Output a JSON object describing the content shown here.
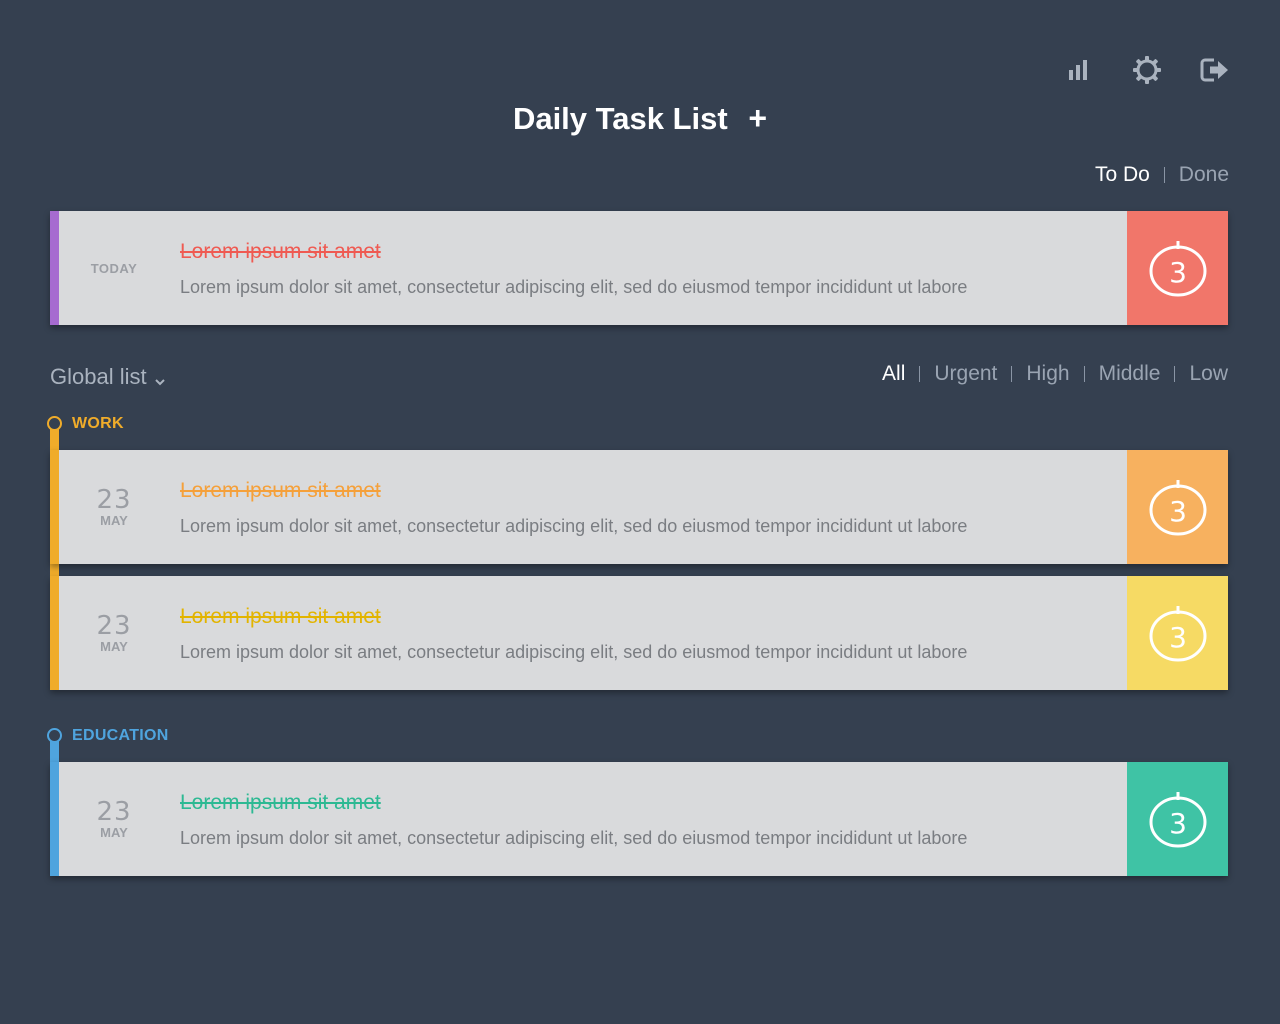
{
  "header": {
    "title": "Daily Task List",
    "add_symbol": "+",
    "icons": [
      "bar-chart-icon",
      "gear-icon",
      "logout-icon"
    ]
  },
  "view_tabs": [
    {
      "label": "To Do",
      "active": true
    },
    {
      "label": "Done",
      "active": false
    }
  ],
  "today_task": {
    "date_label": "TODAY",
    "title": "Lorem ipsum sit amet",
    "description": "Lorem ipsum dolor sit amet, consectetur adipiscing elit, sed do eiusmod tempor incididunt ut labore",
    "pomodoro_count": "3",
    "stripe_color": "#a66bd0",
    "title_color": "#ef5a52",
    "pomo_color": "#f1766a"
  },
  "list_selector": {
    "label": "Global list",
    "icon": "chevron-down-icon"
  },
  "filters": [
    {
      "label": "All",
      "active": true
    },
    {
      "label": "Urgent",
      "active": false
    },
    {
      "label": "High",
      "active": false
    },
    {
      "label": "Middle",
      "active": false
    },
    {
      "label": "Low",
      "active": false
    }
  ],
  "categories": [
    {
      "name": "WORK",
      "color": "#f0ac2a",
      "tasks": [
        {
          "day": "23",
          "month": "MAY",
          "title": "Lorem ipsum sit amet",
          "description": "Lorem ipsum dolor sit amet, consectetur adipiscing elit, sed do eiusmod tempor incididunt ut labore",
          "pomodoro_count": "3",
          "title_color": "#f5a03a",
          "pomo_color": "#f7b15f"
        },
        {
          "day": "23",
          "month": "MAY",
          "title": "Lorem ipsum sit amet",
          "description": "Lorem ipsum dolor sit amet, consectetur adipiscing elit, sed do eiusmod tempor incididunt ut labore",
          "pomodoro_count": "3",
          "title_color": "#e2b400",
          "pomo_color": "#f6da64"
        }
      ]
    },
    {
      "name": "EDUCATION",
      "color": "#4fa4de",
      "tasks": [
        {
          "day": "23",
          "month": "MAY",
          "title": "Lorem ipsum sit amet",
          "description": "Lorem ipsum dolor sit amet, consectetur adipiscing elit, sed do eiusmod tempor incididunt ut labore",
          "pomodoro_count": "3",
          "title_color": "#2db993",
          "pomo_color": "#3fc3a5"
        }
      ]
    }
  ]
}
